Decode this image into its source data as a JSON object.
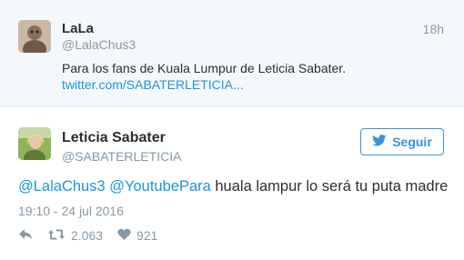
{
  "parent_tweet": {
    "name": "LaLa",
    "handle": "@LalaChus3",
    "time": "18h",
    "text": "Para los fans de Kuala Lumpur de Leticia Sabater.",
    "link": "twitter.com/SABATERLETICIA..."
  },
  "main_tweet": {
    "name": "Leticia Sabater",
    "handle": "@SABATERLETICIA",
    "follow_label": "Seguir",
    "mention_1": "@LalaChus3",
    "mention_2": "@YoutubePara",
    "body": " huala lampur lo será tu puta madre",
    "date": "19:10 - 24 jul 2016",
    "retweets": "2.063",
    "likes": "921"
  },
  "colors": {
    "link_blue": "#1b95e0",
    "button_blue": "#3b94d9",
    "muted_gray": "#8899a6",
    "parent_bg": "#f5f8fa"
  },
  "icons": [
    "reply-icon",
    "retweet-icon",
    "heart-icon",
    "twitter-bird-icon"
  ]
}
